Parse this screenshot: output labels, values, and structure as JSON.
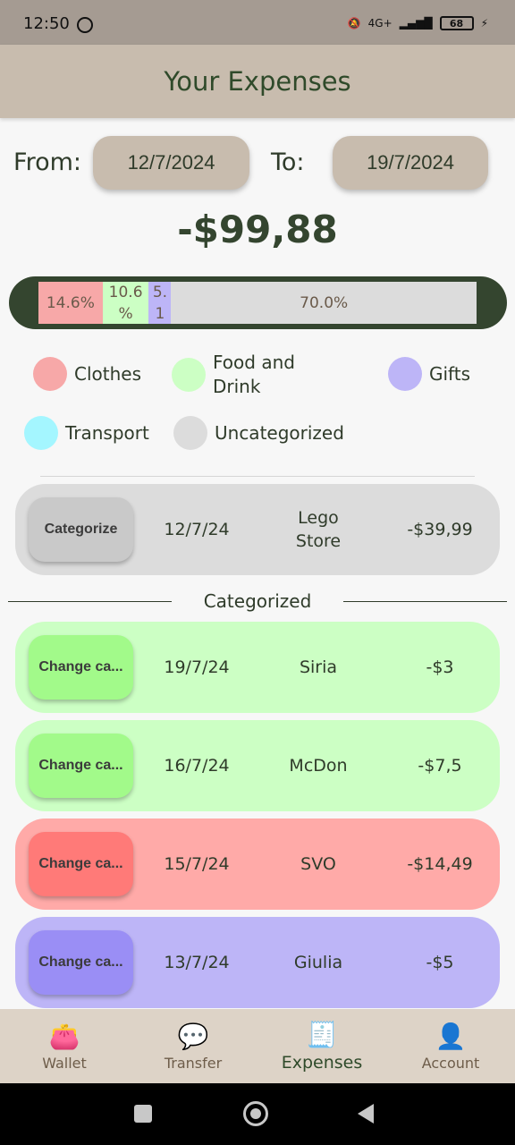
{
  "status": {
    "time": "12:50",
    "network": "4G+",
    "battery": "68"
  },
  "header": {
    "title": "Your Expenses"
  },
  "dates": {
    "from_label": "From:",
    "from_value": "12/7/2024",
    "to_label": "To:",
    "to_value": "19/7/2024"
  },
  "total": "-$99,88",
  "breakdown": [
    {
      "label": "14.6%",
      "fraction": 0.146,
      "color": "#f7a8a8"
    },
    {
      "label": "10.6 %",
      "fraction": 0.106,
      "color": "#ccffc4"
    },
    {
      "label": "5. 1",
      "fraction": 0.051,
      "color": "#bdb5f7"
    },
    {
      "label": "70.0%",
      "fraction": 0.7,
      "color": "#dcdcdc"
    }
  ],
  "legend": [
    {
      "name": "Clothes",
      "color": "#f7a8a8"
    },
    {
      "name": "Food and Drink",
      "color": "#ccffc4"
    },
    {
      "name": "Gifts",
      "color": "#bdb5f7"
    },
    {
      "name": "Transport",
      "color": "#a4f6ff"
    },
    {
      "name": "Uncategorized",
      "color": "#dcdcdc"
    }
  ],
  "uncategorized": [
    {
      "button": "Categorize",
      "date": "12/7/24",
      "name": "Lego Store",
      "amount": "-$39,99",
      "card_color": "#dcdcdc",
      "button_color": "#c9c9c9"
    }
  ],
  "categorized_title": "Categorized",
  "categorized": [
    {
      "button": "Change ca...",
      "date": "19/7/24",
      "name": "Siria",
      "amount": "-$3",
      "card_color": "#ccffc4",
      "button_color": "#a2fa8a"
    },
    {
      "button": "Change ca...",
      "date": "16/7/24",
      "name": "McDon",
      "amount": "-$7,5",
      "card_color": "#ccffc4",
      "button_color": "#a2fa8a"
    },
    {
      "button": "Change ca...",
      "date": "15/7/24",
      "name": "SVO",
      "amount": "-$14,49",
      "card_color": "#ffaaa8",
      "button_color": "#ff7a78"
    },
    {
      "button": "Change ca...",
      "date": "13/7/24",
      "name": "Giulia",
      "amount": "-$5",
      "card_color": "#bdb5f7",
      "button_color": "#9a8ef5"
    }
  ],
  "nav": [
    {
      "label": "Wallet",
      "icon": "wallet-icon"
    },
    {
      "label": "Transfer",
      "icon": "chat-icon"
    },
    {
      "label": "Expenses",
      "icon": "receipt-icon"
    },
    {
      "label": "Account",
      "icon": "account-icon"
    }
  ]
}
